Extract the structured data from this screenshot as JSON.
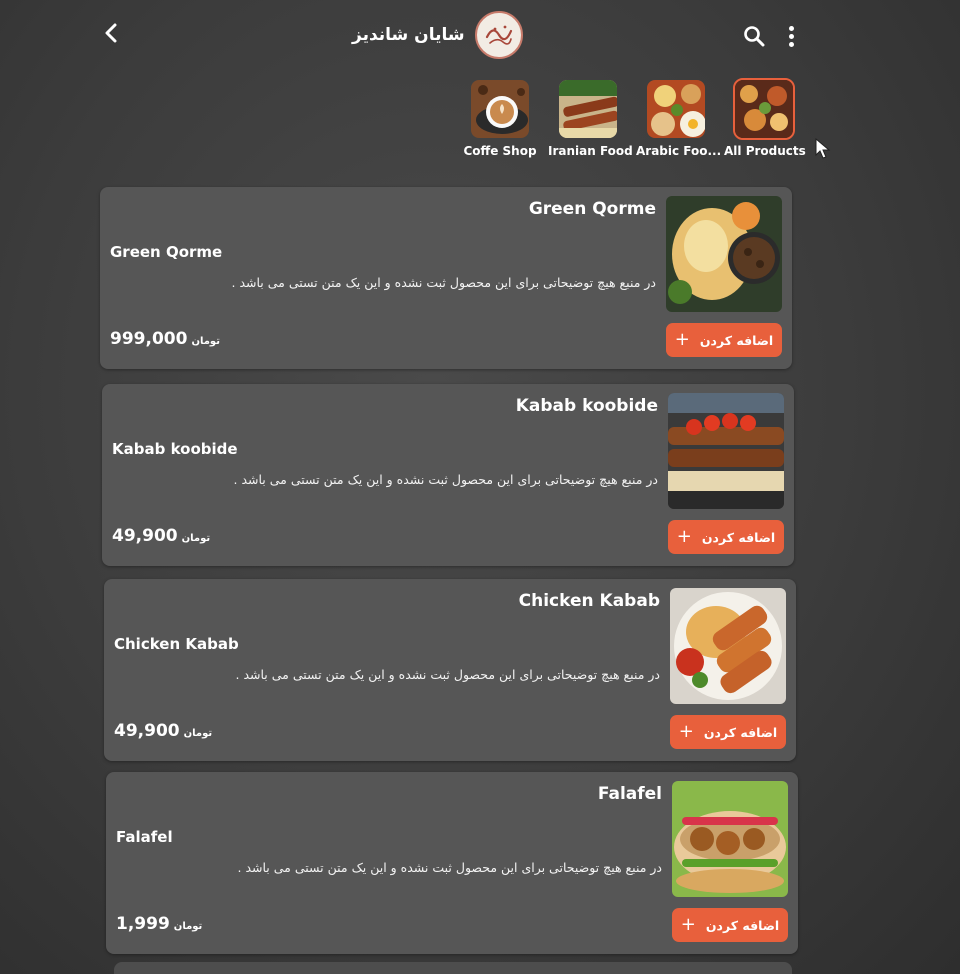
{
  "header": {
    "store_name": "شایان شاندیز"
  },
  "categories": [
    {
      "label": "Coffe Shop",
      "thumb": "coffee"
    },
    {
      "label": "Iranian Food",
      "thumb": "iranian"
    },
    {
      "label": "Arabic Foo...",
      "thumb": "arabic"
    },
    {
      "label": "All Products",
      "thumb": "all",
      "active": true
    }
  ],
  "products": [
    {
      "title": "Green Qorme",
      "subtitle": "Green Qorme",
      "description": "در منبع هیچ توضیحاتی برای این محصول ثبت نشده و این یک متن تستی می باشد .",
      "price": "999,000",
      "currency": "تومان",
      "add_label": "اضافه کردن",
      "thumb": "qorme"
    },
    {
      "title": "Kabab koobide",
      "subtitle": "Kabab koobide",
      "description": "در منبع هیچ توضیحاتی برای این محصول ثبت نشده و این یک متن تستی می باشد .",
      "price": "49,900",
      "currency": "تومان",
      "add_label": "اضافه کردن",
      "thumb": "koobide"
    },
    {
      "title": "Chicken Kabab",
      "subtitle": "Chicken Kabab",
      "description": "در منبع هیچ توضیحاتی برای این محصول ثبت نشده و این یک متن تستی می باشد .",
      "price": "49,900",
      "currency": "تومان",
      "add_label": "اضافه کردن",
      "thumb": "chicken"
    },
    {
      "title": "Falafel",
      "subtitle": "Falafel",
      "description": "در منبع هیچ توضیحاتی برای این محصول ثبت نشده و این یک متن تستی می باشد .",
      "price": "1,999",
      "currency": "تومان",
      "add_label": "اضافه کردن",
      "thumb": "falafel"
    }
  ],
  "colors": {
    "accent": "#e8603c",
    "card": "#565656",
    "background": "#3b3b3b"
  },
  "icons": [
    "chevron-left-icon",
    "search-icon",
    "more-vertical-icon",
    "plus-icon",
    "mouse-cursor-icon"
  ]
}
